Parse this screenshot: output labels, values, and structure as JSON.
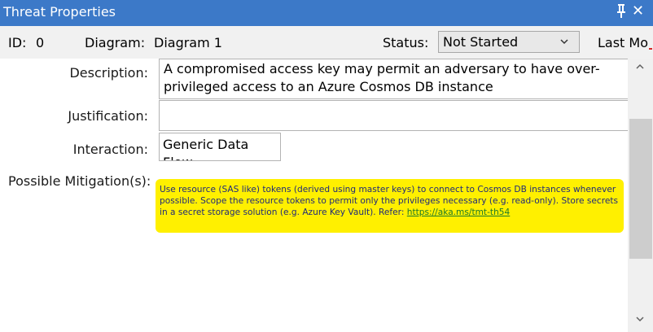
{
  "window": {
    "title": "Threat Properties"
  },
  "header": {
    "id_label": "ID:",
    "id_value": "0",
    "diagram_label": "Diagram:",
    "diagram_value": "Diagram 1",
    "status_label": "Status:",
    "status_value": "Not Started",
    "last_modified_label": "Last Mo"
  },
  "fields": {
    "description_label": "Description:",
    "description_value": "A compromised access key may permit an adversary to have over-privileged access to an Azure Cosmos DB instance",
    "justification_label": "Justification:",
    "justification_value": "",
    "interaction_label": "Interaction:",
    "interaction_value": "Generic Data Flow",
    "mitigation_label": "Possible Mitigation(s):",
    "mitigation_text": "Use resource (SAS like) tokens (derived using master keys) to connect to Cosmos DB instances whenever possible. Scope the resource tokens to permit only the privileges necessary (e.g. read-only). Store secrets in a secret storage solution (e.g. Azure Key Vault). Refer: ",
    "mitigation_link": "https://aka.ms/tmt-th54"
  },
  "colors": {
    "title_bar": "#3c79c8",
    "highlight": "#fff000",
    "link": "#1a7a2a"
  },
  "icons": {
    "pin": "pin-icon",
    "close": "close-icon",
    "dropdown": "chevron-down-icon"
  }
}
